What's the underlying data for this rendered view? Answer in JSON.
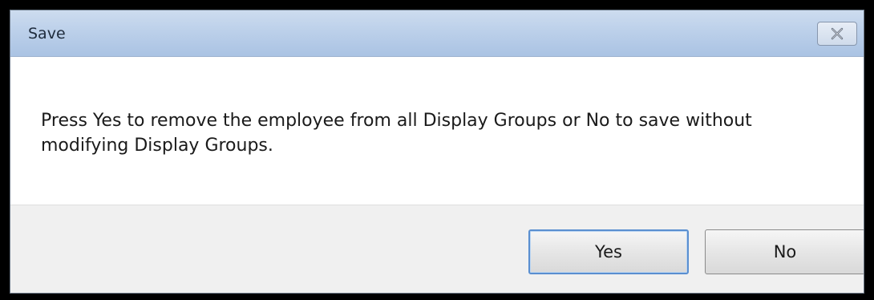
{
  "dialog": {
    "title": "Save",
    "message": "Press Yes to remove the employee from all Display Groups or No to save without modifying Display Groups.",
    "close_icon": "close-icon",
    "buttons": {
      "yes_label": "Yes",
      "no_label": "No"
    }
  }
}
